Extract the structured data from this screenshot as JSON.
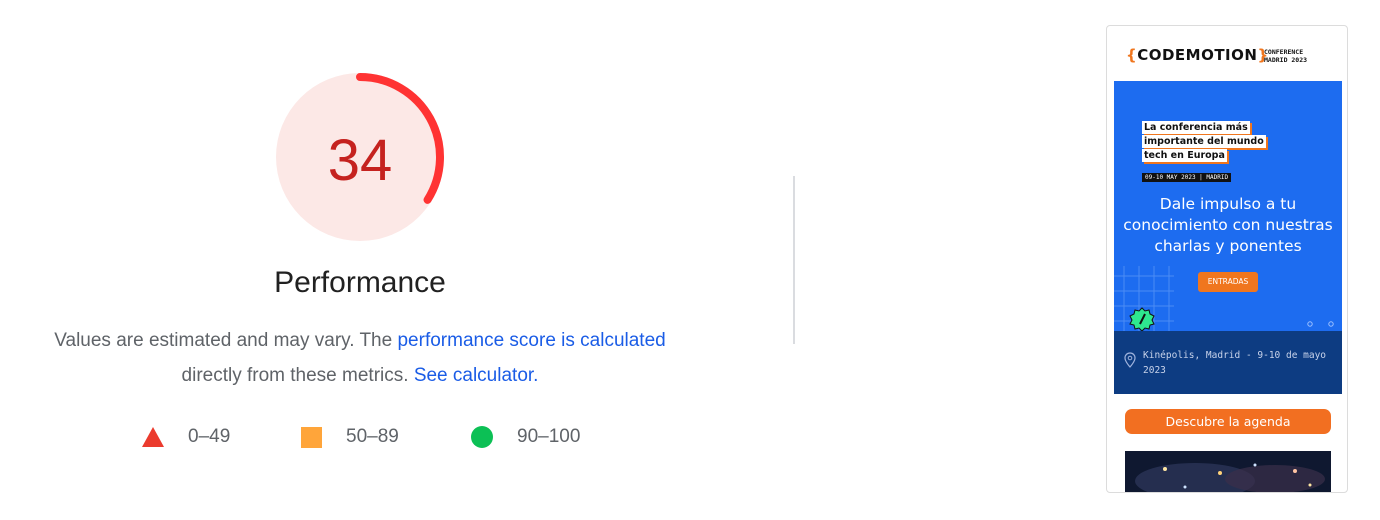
{
  "performance": {
    "score": "34",
    "score_value": 34,
    "title": "Performance",
    "colors": {
      "fail": "#c5221f",
      "fail_arc": "#ff3333",
      "fail_bg": "#fce8e6"
    }
  },
  "description": {
    "text_before": "Values are estimated and may vary. The ",
    "link1": "performance score is calculated",
    "text_middle": "directly from these metrics. ",
    "link2": "See calculator."
  },
  "legend": {
    "fail": "0–49",
    "average": "50–89",
    "pass": "90–100",
    "colors": {
      "fail": "#eb3b2e",
      "average": "#ffa53a",
      "pass": "#0cc055"
    }
  },
  "screenshot": {
    "logo_left_brace": "{",
    "logo_text": "CODEMOTION",
    "logo_right_brace": "}",
    "conf_line1": "CONFERENCE",
    "conf_line2": "MADRID 2023",
    "tagline1": "La conferencia más",
    "tagline2": "importante del mundo",
    "tagline3": "tech en Europa",
    "date_tag": "09-10 MAY 2023 | MADRID",
    "headline": "Dale impulso a tu conocimiento con nuestras charlas y ponentes",
    "entradas": "ENTRADAS",
    "location": "Kinépolis, Madrid - 9-10 de mayo 2023",
    "agenda_button": "Descubre la agenda",
    "colors": {
      "brand_blue": "#1d6cf0",
      "dark_blue": "#0d3c82",
      "orange": "#f26f21"
    }
  }
}
